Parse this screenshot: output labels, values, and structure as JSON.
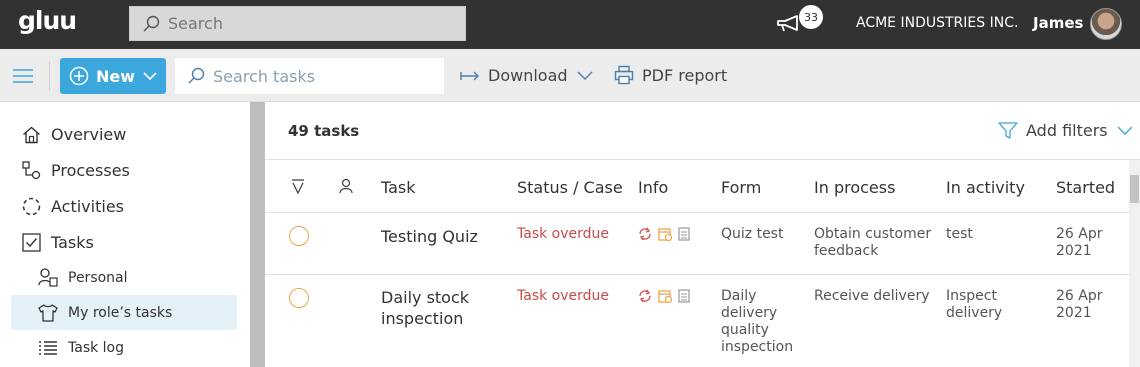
{
  "topbar": {
    "logo": "gluu",
    "search_placeholder": "Search",
    "notification_count": "33",
    "company": "ACME INDUSTRIES INC.",
    "username": "James"
  },
  "toolbar": {
    "new_label": "New",
    "task_search_placeholder": "Search tasks",
    "download_label": "Download",
    "pdf_label": "PDF report"
  },
  "sidebar": {
    "items": [
      {
        "label": "Overview",
        "icon": "home-icon"
      },
      {
        "label": "Processes",
        "icon": "process-icon"
      },
      {
        "label": "Activities",
        "icon": "activities-icon"
      },
      {
        "label": "Tasks",
        "icon": "checkbox-icon"
      }
    ],
    "subitems": [
      {
        "label": "Personal",
        "icon": "person-icon"
      },
      {
        "label": "My role’s tasks",
        "icon": "shirt-icon",
        "active": true
      },
      {
        "label": "Task log",
        "icon": "list-icon"
      }
    ]
  },
  "main": {
    "task_count": "49 tasks",
    "add_filters": "Add filters",
    "columns": [
      "Task",
      "Status / Case",
      "Info",
      "Form",
      "In process",
      "In activity",
      "Started"
    ],
    "rows": [
      {
        "task": "Testing Quiz",
        "status": "Task overdue",
        "form": "Quiz test",
        "process": "Obtain customer feedback",
        "activity": "test",
        "started": "26 Apr 2021"
      },
      {
        "task": "Daily stock inspection",
        "status": "Task overdue",
        "form": "Daily delivery quality inspection",
        "process": "Receive delivery",
        "activity": "Inspect delivery",
        "started": "26 Apr 2021"
      }
    ]
  },
  "colors": {
    "topbar": "#333233",
    "accent": "#3ca7dd",
    "overdue": "#c94a4a",
    "status_circle": "#f0a44a"
  }
}
